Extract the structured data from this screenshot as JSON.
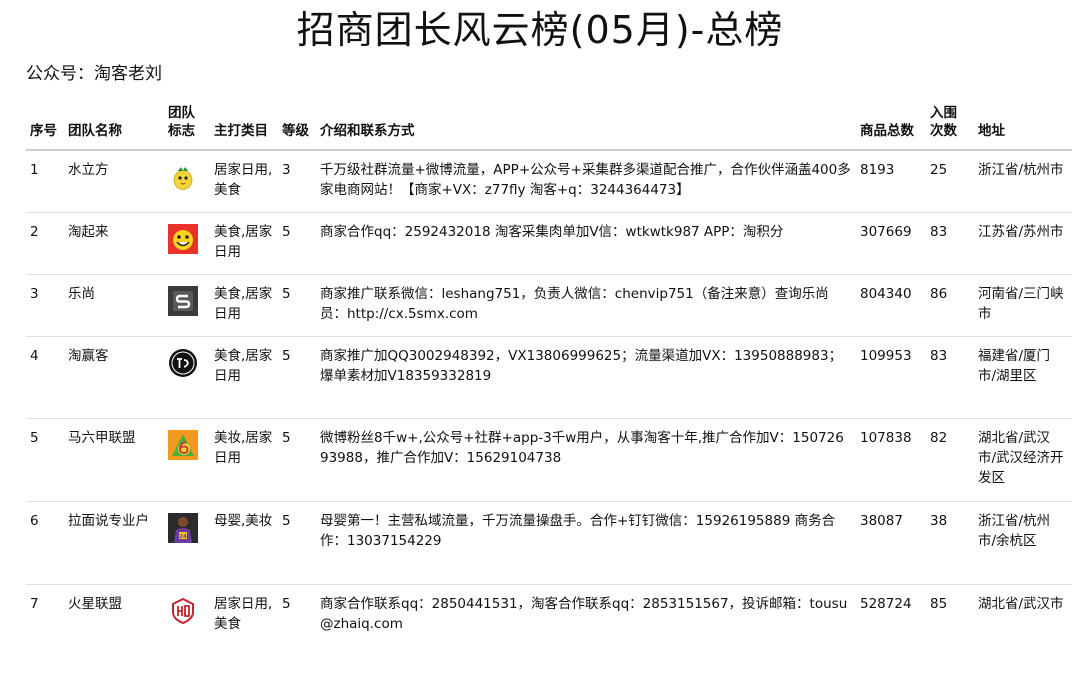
{
  "header": {
    "title": "招商团长风云榜(05月)-总榜",
    "subtitle": "公众号：淘客老刘"
  },
  "table": {
    "columns": {
      "rank": "序号",
      "name": "团队名称",
      "logo": "团队标志",
      "category": "主打类目",
      "level": "等级",
      "intro": "介绍和联系方式",
      "goods": "商品总数",
      "entries": "入围次数",
      "address": "地址"
    },
    "rows": [
      {
        "rank": "1",
        "name": "水立方",
        "logo_icon": "yellow-bird-logo-icon",
        "category": "居家日用,美食",
        "level": "3",
        "intro": "千万级社群流量+微博流量，APP+公众号+采集群多渠道配合推广，合作伙伴涵盖400多家电商网站！【商家+VX：z77fly 淘客+q：3244364473】",
        "goods": "8193",
        "entries": "25",
        "address": "浙江省/杭州市"
      },
      {
        "rank": "2",
        "name": "淘起来",
        "logo_icon": "red-smiley-logo-icon",
        "category": "美食,居家日用",
        "level": "5",
        "intro": "商家合作qq：2592432018 淘客采集肉单加V信：wtkwtk987 APP：淘积分",
        "goods": "307669",
        "entries": "83",
        "address": "江苏省/苏州市"
      },
      {
        "rank": "3",
        "name": "乐尚",
        "logo_icon": "grey-s-logo-icon",
        "category": "美食,居家日用",
        "level": "5",
        "intro": "商家推广联系微信：leshang751，负责人微信：chenvip751（备注来意）查询乐尚员：http://cx.5smx.com",
        "goods": "804340",
        "entries": "86",
        "address": "河南省/三门峡市"
      },
      {
        "rank": "4",
        "name": "淘赢客",
        "logo_icon": "black-circle-logo-icon",
        "category": "美食,居家日用",
        "level": "5",
        "intro": "商家推广加QQ3002948392，VX13806999625；流量渠道加VX：13950888983；爆单素材加V18359332819",
        "goods": "109953",
        "entries": "83",
        "address": "福建省/厦门市/湖里区"
      },
      {
        "rank": "5",
        "name": "马六甲联盟",
        "logo_icon": "orange-six-logo-icon",
        "category": "美妆,居家日用",
        "level": "5",
        "intro": "微博粉丝8千w+,公众号+社群+app-3千w用户，从事淘客十年,推广合作加V：15072693988，推广合作加V：15629104738",
        "goods": "107838",
        "entries": "82",
        "address": "湖北省/武汉市/武汉经济开发区"
      },
      {
        "rank": "6",
        "name": "拉面说专业户",
        "logo_icon": "player-photo-logo-icon",
        "category": "母婴,美妆",
        "level": "5",
        "intro": "母婴第一！主营私域流量，千万流量操盘手。合作+钉钉微信：15926195889 商务合作：13037154229",
        "goods": "38087",
        "entries": "38",
        "address": "浙江省/杭州市/余杭区"
      },
      {
        "rank": "7",
        "name": "火星联盟",
        "logo_icon": "red-emblem-logo-icon",
        "category": "居家日用,美食",
        "level": "5",
        "intro": "商家合作联系qq：2850441531，淘客合作联系qq：2853151567，投诉邮箱：tousu@zhaiq.com",
        "goods": "528724",
        "entries": "85",
        "address": "湖北省/武汉市"
      }
    ]
  }
}
